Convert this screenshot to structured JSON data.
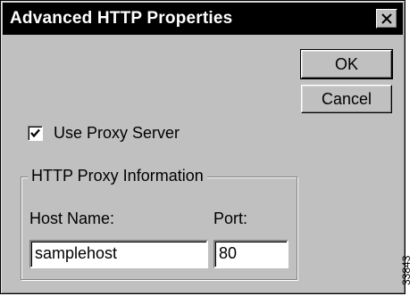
{
  "window": {
    "title": "Advanced HTTP Properties",
    "close_icon": "close-x-icon"
  },
  "buttons": {
    "ok_label": "OK",
    "cancel_label": "Cancel"
  },
  "proxy": {
    "use_proxy_label": "Use Proxy Server",
    "use_proxy_checked": true,
    "group_title": "HTTP Proxy Information",
    "host_label": "Host Name:",
    "host_value": "samplehost",
    "port_label": "Port:",
    "port_value": "80"
  },
  "figure_code": "33843"
}
